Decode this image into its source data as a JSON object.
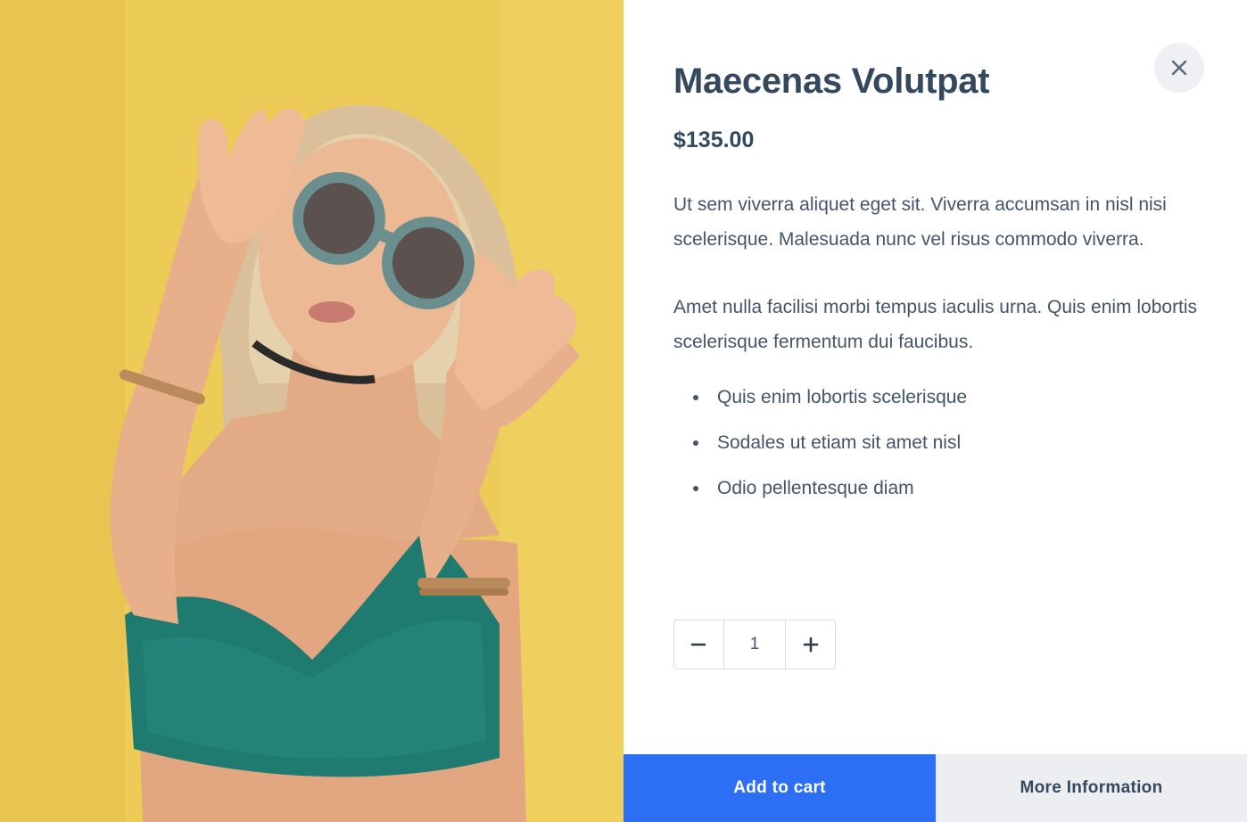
{
  "product": {
    "title": "Maecenas Volutpat",
    "price": "$135.00",
    "description": [
      "Ut sem viverra aliquet eget sit. Viverra accumsan in nisl nisi scelerisque. Malesuada nunc vel risus commodo viverra.",
      "Amet nulla facilisi morbi tempus iaculis urna. Quis enim lobortis scelerisque fermentum dui faucibus."
    ],
    "features": [
      "Quis enim lobortis scelerisque",
      "Sodales ut etiam sit amet nisl",
      "Odio pellentesque diam"
    ],
    "quantity": "1"
  },
  "actions": {
    "add_to_cart": "Add to cart",
    "more_info": "More Information"
  },
  "icons": {
    "close": "close-icon",
    "decrement": "minus-icon",
    "increment": "plus-icon"
  },
  "colors": {
    "primary": "#2c6ff5",
    "secondary_button": "#eceef2",
    "heading": "#34495e",
    "body_text": "#44556a",
    "photo_background": "#e9c955"
  }
}
